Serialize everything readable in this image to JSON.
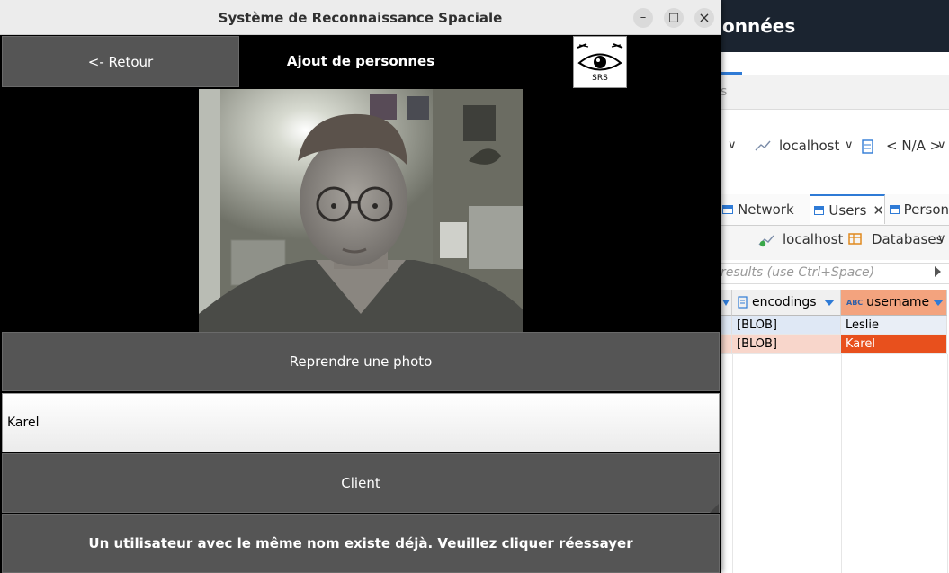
{
  "app": {
    "window_title": "Système de Reconnaissance Spaciale",
    "window_controls": {
      "minimize": "–",
      "maximize": "□",
      "close": "×"
    },
    "back_label": "<- Retour",
    "page_heading": "Ajout de personnes",
    "logo_text": "SRS",
    "retake_label": "Reprendre une photo",
    "name_value": "Karel",
    "client_label": "Client",
    "status_message": "Un utilisateur avec le même nom existe déjà. Veuillez cliquer réessayer"
  },
  "background": {
    "title_fragment": "onnées",
    "tab_hint": "s",
    "connection": {
      "host": "localhost",
      "schema": "< N/A >"
    },
    "tabs": [
      {
        "label": "Network"
      },
      {
        "label": "Users",
        "active": true
      },
      {
        "label": "Person"
      }
    ],
    "toolbar": {
      "host": "localhost",
      "databases": "Databases"
    },
    "filter_placeholder": "results (use Ctrl+Space)",
    "grid": {
      "columns": [
        {
          "label": "encodings"
        },
        {
          "label": "username",
          "type_badge": "ABC"
        }
      ],
      "rows": [
        {
          "encodings": "[BLOB]",
          "username": "Leslie"
        },
        {
          "encodings": "[BLOB]",
          "username": "Karel"
        }
      ]
    }
  },
  "colors": {
    "button_bg": "#555555",
    "selected_cell": "#e8501d",
    "selected_header": "#f3a37e",
    "accent": "#2f7bd6"
  }
}
